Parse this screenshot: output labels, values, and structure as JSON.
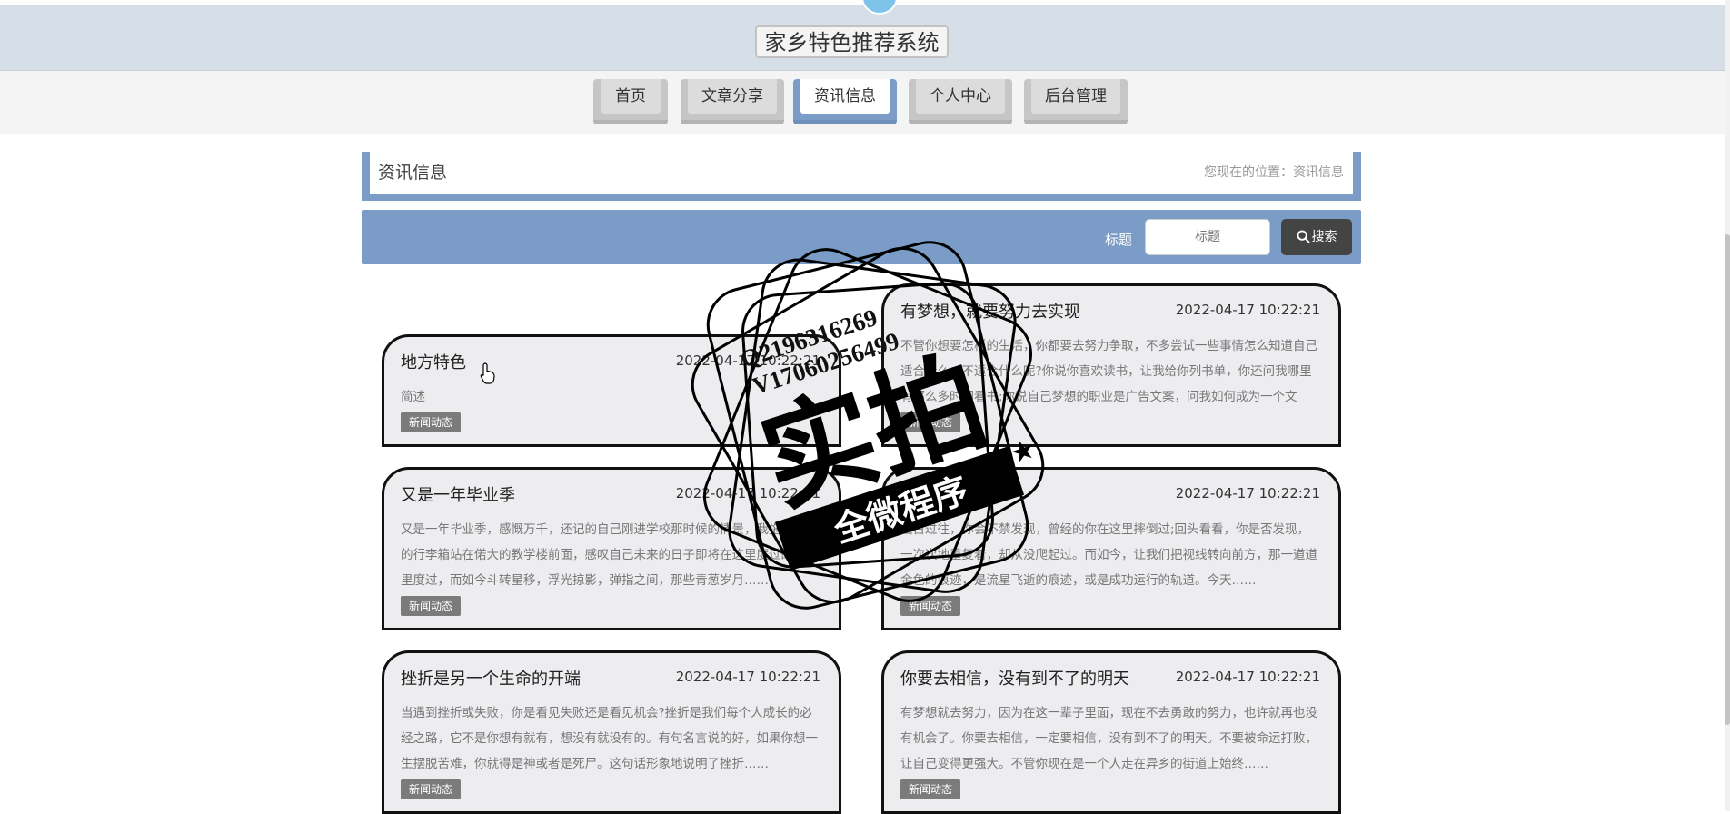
{
  "header": {
    "title": "家乡特色推荐系统"
  },
  "nav": [
    {
      "label": "首页",
      "active": false
    },
    {
      "label": "文章分享",
      "active": false
    },
    {
      "label": "资讯信息",
      "active": true
    },
    {
      "label": "个人中心",
      "active": false
    },
    {
      "label": "后台管理",
      "active": false
    }
  ],
  "breadcrumb": {
    "title": "资讯信息",
    "location": "您现在的位置：资讯信息"
  },
  "search": {
    "label": "标题",
    "placeholder": "标题",
    "button": "搜索"
  },
  "cards": [
    {
      "title": "有梦想，就要努力去实现",
      "date": "2022-04-17 10:22:21",
      "excerpt": "不管你想要怎样的生活，你都要去努力争取，不多尝试一些事情怎么知道自己适合什么、不适合什么呢?你说你喜欢读书，让我给你列书单，你还问我哪里有那么多时间看书;你说自己梦想的职业是广告文案，问我如何成为一个文案……",
      "tag": "新闻动态"
    },
    {
      "title": "地方特色",
      "date": "2022-04-17 10:22:21",
      "excerpt": "简述",
      "tag": "新闻动态"
    },
    {
      "title": "又是一年毕业季",
      "date": "2022-04-17 10:22:21",
      "excerpt": "又是一年毕业季，感慨万千，还记的自己刚进学校那时候的情景，我拖着沉重的行李箱站在偌大的教学楼前面，感叹自己未来的日子即将在这里度过的校园里度过，而如今斗转星移，浮光掠影，弹指之间，那些青葱岁月……",
      "tag": "新闻动态"
    },
    {
      "title": "理想常在心间",
      "date": "2022-04-17 10:22:21",
      "excerpt": "回首过往，你会不禁发现，曾经的你在这里摔倒过;回头看看，你是否发现，一次次地重复着，却从没爬起过。而如今，让我们把视线转向前方，那一道道金色的痕迹，是流星飞逝的痕迹，或是成功运行的轨道。今天……",
      "tag": "新闻动态"
    },
    {
      "title": "挫折是另一个生命的开端",
      "date": "2022-04-17 10:22:21",
      "excerpt": "当遇到挫折或失败，你是看见失败还是看见机会?挫折是我们每个人成长的必经之路，它不是你想有就有，想没有就没有的。有句名言说的好，如果你想一生摆脱苦难，你就得是神或者是死尸。这句话形象地说明了挫折……",
      "tag": "新闻动态"
    },
    {
      "title": "你要去相信，没有到不了的明天",
      "date": "2022-04-17 10:22:21",
      "excerpt": "有梦想就去努力，因为在这一辈子里面，现在不去勇敢的努力，也许就再也没有机会了。你要去相信，一定要相信，没有到不了的明天。不要被命运打败，让自己变得更强大。不管你现在是一个人走在异乡的街道上始终……",
      "tag": "新闻动态"
    }
  ],
  "watermark": {
    "line1": "Q2196316269",
    "line2": "V17060256499",
    "main": "实拍",
    "banner": "全微程序"
  }
}
